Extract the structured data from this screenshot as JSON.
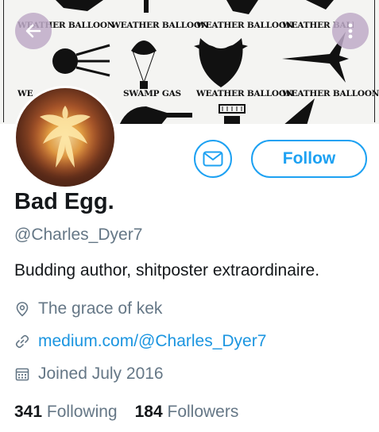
{
  "banner": {
    "labels": [
      "WEATHER BALLOON",
      "WEATHER BALLOON",
      "WEATHER BALLOON",
      "WEATHER BALLOON",
      "SWAMP GAS",
      "WEATHER BALLOON",
      "WEATHER BALLOON"
    ],
    "partial_label": "WE"
  },
  "profile": {
    "name": "Bad Egg.",
    "handle": "@Charles_Dyer7",
    "bio": "Budding author, shitposter extraordinaire.",
    "location": "The grace of kek",
    "website": "medium.com/@Charles_Dyer7",
    "joined": "Joined July 2016"
  },
  "actions": {
    "follow_label": "Follow"
  },
  "stats": {
    "following_count": "341",
    "following_label": "Following",
    "followers_count": "184",
    "followers_label": "Followers"
  },
  "colors": {
    "accent": "#1da1f2",
    "link": "#1b95e0",
    "secondary_text": "#657786",
    "primary_text": "#14171a"
  },
  "icons": [
    "back-arrow-icon",
    "more-vertical-icon",
    "envelope-icon",
    "location-pin-icon",
    "link-icon",
    "calendar-icon"
  ]
}
